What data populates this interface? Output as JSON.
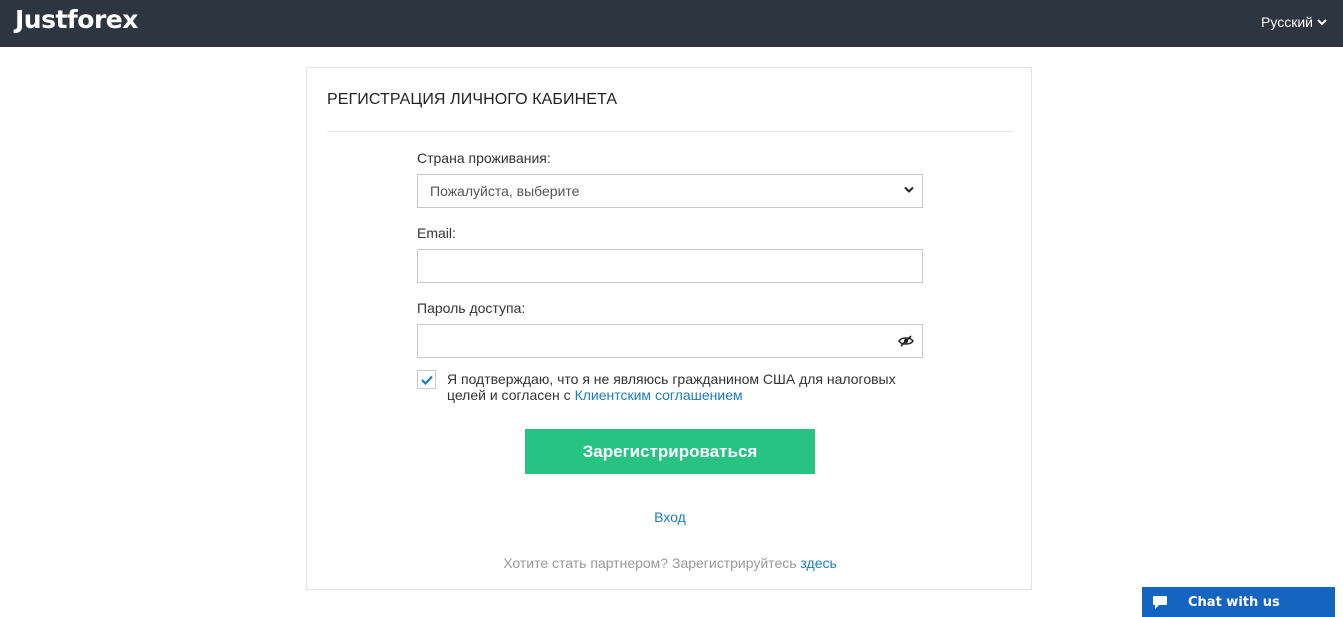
{
  "header": {
    "logo_text": "Justforex",
    "language": "Русский",
    "bg_color": "#2d3640"
  },
  "form": {
    "title": "РЕГИСТРАЦИЯ ЛИЧНОГО КАБИНЕТА",
    "country_label": "Страна проживания:",
    "country_selected": "Пожалуйста, выберите",
    "email_label": "Email:",
    "email_value": "",
    "password_label": "Пароль доступа:",
    "password_value": "",
    "consent_checked": true,
    "consent_text": "Я подтверждаю, что я не являюсь гражданином США для налоговых целей и согласен с ",
    "consent_link": "Клиентским соглашением",
    "submit_label": "Зарегистрироваться",
    "login_link": "Вход",
    "partner_text": "Хотите стать партнером? Зарегистрируйтесь ",
    "partner_link": "здесь"
  },
  "chat": {
    "label": "Chat with us",
    "icon": "chat-bubble-icon"
  },
  "colors": {
    "accent_green": "#27c383",
    "link_blue": "#1a7dc2",
    "chat_blue": "#1565c0"
  }
}
